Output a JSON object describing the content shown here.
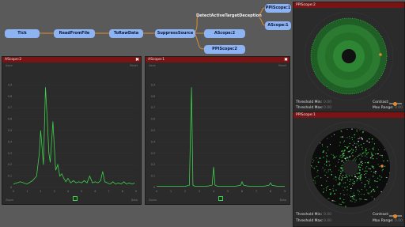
{
  "graph": {
    "nodes": {
      "tick": "Tick",
      "read_from_file": "ReadFromFile",
      "to_raw_data": "ToRawData",
      "suppress_source": "SuppressSource",
      "detect_active": "DetectActiveTargetDeception",
      "ppiscope1_node": "PPIScope:1",
      "ascope1_node": "AScope:1",
      "ascope2_node": "AScope:2",
      "ppiscope2_node": "PPIScope:2"
    }
  },
  "ascope2": {
    "title": "AScope:2",
    "close": "✖",
    "toolbar_left": "Save",
    "toolbar_right": "Reset",
    "footer_left": "Zoom",
    "footer_right": "Data",
    "line_color": "#3ed14a",
    "chart_data": {
      "type": "line",
      "title": "",
      "xlabel": "",
      "ylabel": "",
      "xlim": [
        0,
        9
      ],
      "ylim": [
        0,
        1
      ],
      "xticks": [
        "0",
        "1",
        "2",
        "3",
        "4",
        "5",
        "6",
        "7",
        "8",
        "9"
      ],
      "yticks": [
        "0.9",
        "0.8",
        "0.7",
        "0.6",
        "0.5",
        "0.4",
        "0.3",
        "0.2",
        "0.1",
        "0"
      ],
      "series": [
        {
          "x": [
            0,
            0.5,
            1,
            1.4,
            1.7,
            1.9,
            2.0,
            2.1,
            2.2,
            2.35,
            2.5,
            2.6,
            2.7,
            2.8,
            2.9,
            3.0,
            3.1,
            3.25,
            3.4,
            3.55,
            3.7,
            3.85,
            4.0,
            4.2,
            4.4,
            4.6,
            4.8,
            5.0,
            5.2,
            5.4,
            5.6,
            5.8,
            6.0,
            6.2,
            6.4,
            6.55,
            6.7,
            6.9,
            7.1,
            7.3,
            7.5,
            7.7,
            7.9,
            8.1,
            8.3,
            8.5,
            8.7,
            8.9
          ],
          "y": [
            0.03,
            0.05,
            0.03,
            0.06,
            0.1,
            0.3,
            0.5,
            0.35,
            0.2,
            0.88,
            0.55,
            0.3,
            0.22,
            0.4,
            0.58,
            0.35,
            0.15,
            0.2,
            0.1,
            0.12,
            0.08,
            0.05,
            0.08,
            0.04,
            0.06,
            0.04,
            0.05,
            0.04,
            0.06,
            0.04,
            0.1,
            0.04,
            0.05,
            0.04,
            0.06,
            0.14,
            0.05,
            0.04,
            0.03,
            0.05,
            0.03,
            0.04,
            0.03,
            0.05,
            0.03,
            0.04,
            0.03,
            0.04
          ]
        }
      ]
    }
  },
  "ascope1": {
    "title": "AScope:1",
    "close": "✖",
    "toolbar_left": "Save",
    "toolbar_right": "Reset",
    "footer_left": "Zoom",
    "footer_right": "Data",
    "line_color": "#3ed14a",
    "chart_data": {
      "type": "line",
      "title": "",
      "xlabel": "",
      "ylabel": "",
      "xlim": [
        0,
        9
      ],
      "ylim": [
        0,
        1
      ],
      "xticks": [
        "0",
        "1",
        "2",
        "3",
        "4",
        "5",
        "6",
        "7",
        "8",
        "9"
      ],
      "yticks": [
        "0.9",
        "0.8",
        "0.7",
        "0.6",
        "0.5",
        "0.4",
        "0.3",
        "0.2",
        "0.1",
        "0"
      ],
      "series": [
        {
          "x": [
            0,
            0.5,
            1,
            1.5,
            2.0,
            2.3,
            2.45,
            2.55,
            2.7,
            3.0,
            3.5,
            3.9,
            4.0,
            4.1,
            4.3,
            4.6,
            5.0,
            5.5,
            5.9,
            6.0,
            6.1,
            6.5,
            7.0,
            7.5,
            7.9,
            8.0,
            8.1,
            8.5,
            9.0
          ],
          "y": [
            0.01,
            0.01,
            0.01,
            0.01,
            0.01,
            0.02,
            0.88,
            0.02,
            0.01,
            0.01,
            0.01,
            0.02,
            0.18,
            0.02,
            0.01,
            0.01,
            0.01,
            0.01,
            0.02,
            0.05,
            0.02,
            0.01,
            0.01,
            0.01,
            0.02,
            0.04,
            0.02,
            0.01,
            0.01
          ]
        }
      ]
    }
  },
  "ppiscope2": {
    "title": "PPIScope:2",
    "threshold_min_label": "Threshold Min:",
    "threshold_min_value": "0.00",
    "threshold_max_label": "Threshold Max:",
    "threshold_max_value": "0.00",
    "contrast_label": "Contrast:",
    "max_range_label": "Max Range:",
    "max_range_value": "0.00",
    "contrast_level": 0.5
  },
  "ppiscope1": {
    "title": "PPIScope:1",
    "threshold_min_label": "Threshold Min:",
    "threshold_min_value": "0.00",
    "threshold_max_label": "Threshold Max:",
    "threshold_max_value": "0.00",
    "contrast_label": "Contrast:",
    "max_range_label": "Max Range:",
    "max_range_value": "0.00",
    "contrast_level": 0.5
  },
  "colors": {
    "node": "#8db3f2",
    "edge": "#e28a2b",
    "title_bar": "#7a1414",
    "plot_bg": "#2b2b2b",
    "radar_green": "#3ed14a"
  }
}
